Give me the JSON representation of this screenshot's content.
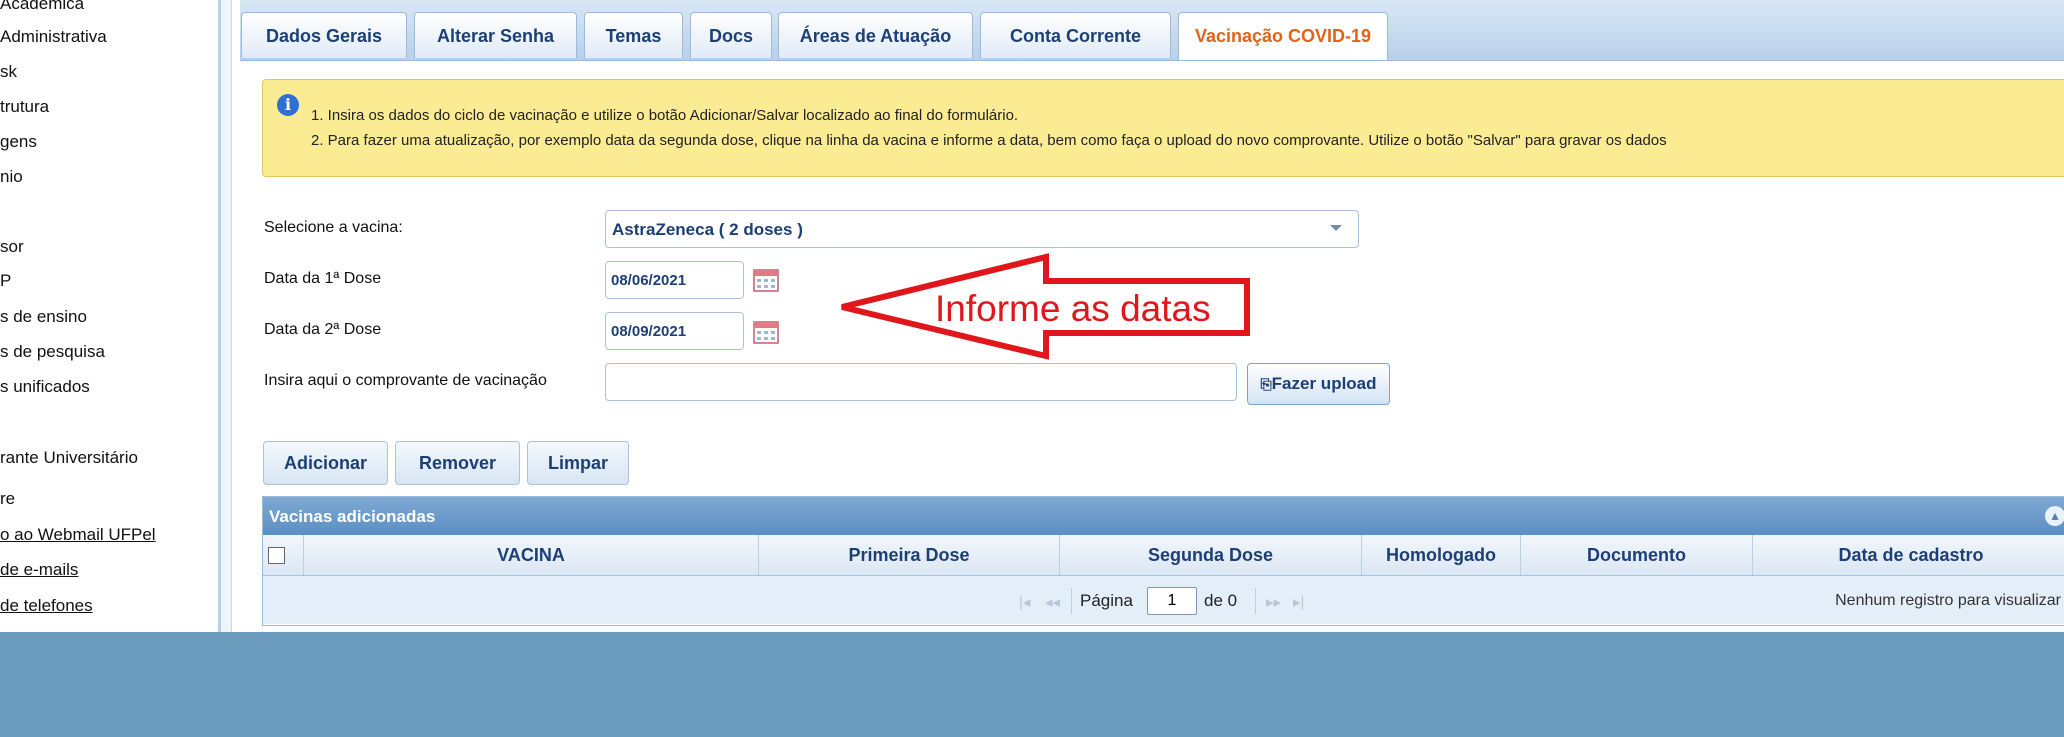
{
  "sidebar": {
    "items": [
      {
        "label": "Acadêmica",
        "link": false
      },
      {
        "label": "Administrativa",
        "link": false
      },
      {
        "label": "sk",
        "link": false
      },
      {
        "label": "trutura",
        "link": false
      },
      {
        "label": "gens",
        "link": false
      },
      {
        "label": "nio",
        "link": false
      },
      {
        "label": "sor",
        "link": false
      },
      {
        "label": "P",
        "link": false
      },
      {
        "label": "s de ensino",
        "link": false
      },
      {
        "label": "s de pesquisa",
        "link": false
      },
      {
        "label": "s unificados",
        "link": false
      },
      {
        "label": "rante Universitário",
        "link": false
      },
      {
        "label": "re",
        "link": false
      },
      {
        "label": "o ao Webmail UFPel",
        "link": true
      },
      {
        "label": "de e-mails",
        "link": true
      },
      {
        "label": "de telefones",
        "link": true
      }
    ]
  },
  "tabs": [
    {
      "label": "Dados Gerais",
      "active": false
    },
    {
      "label": "Alterar Senha",
      "active": false
    },
    {
      "label": "Temas",
      "active": false
    },
    {
      "label": "Docs",
      "active": false
    },
    {
      "label": "Áreas de Atuação",
      "active": false
    },
    {
      "label": "Conta Corrente",
      "active": false
    },
    {
      "label": "Vacinação COVID-19",
      "active": true
    }
  ],
  "info": {
    "line1": "1. Insira os dados do ciclo de vacinação e utilize o botão Adicionar/Salvar localizado ao final do formulário.",
    "line2": "2. Para fazer uma atualização, por exemplo data da segunda dose, clique na linha da vacina e informe a data, bem como faça o upload do novo comprovante. Utilize o botão \"Salvar\" para gravar os dados",
    "icon": "info-icon"
  },
  "form": {
    "vaccine_label": "Selecione a vacina:",
    "vaccine_value": "AstraZeneca ( 2 doses )",
    "dose1_label": "Data da 1ª Dose",
    "dose1_value": "08/06/2021",
    "dose2_label": "Data da 2ª Dose",
    "dose2_value": "08/09/2021",
    "upload_label": "Insira aqui o comprovante de vacinação",
    "upload_button": "Fazer upload"
  },
  "annotation": {
    "text": "Informe as datas",
    "color": "#e1161b"
  },
  "actions": {
    "add": "Adicionar",
    "remove": "Remover",
    "clear": "Limpar"
  },
  "grid": {
    "title": "Vacinas adicionadas",
    "columns": [
      "VACINA",
      "Primeira Dose",
      "Segunda Dose",
      "Homologado",
      "Documento",
      "Data de cadastro"
    ],
    "pager": {
      "page_label": "Página",
      "page_value": "1",
      "of_label": "de 0",
      "empty_message": "Nenhum registro para visualizar"
    }
  },
  "colors": {
    "accent_tab": "#e0631a",
    "link_blue": "#1c3f75",
    "info_bg": "#fbeb93",
    "footer_bg": "#6b9bbd"
  }
}
